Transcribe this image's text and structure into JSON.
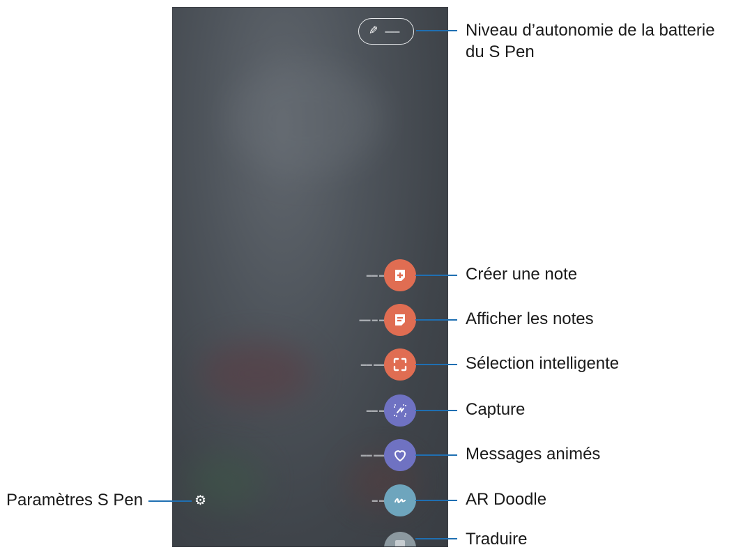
{
  "screen": {
    "battery_icon": "s-pen-icon",
    "settings_icon": "gear-icon",
    "shortcuts": [
      {
        "id": "create-note",
        "color": "#e06d52",
        "icon": "note-plus-icon"
      },
      {
        "id": "view-notes",
        "color": "#e06d52",
        "icon": "note-list-icon"
      },
      {
        "id": "smart-select",
        "color": "#e06d52",
        "icon": "crop-select-icon"
      },
      {
        "id": "screen-write",
        "color": "#6f72c2",
        "icon": "screen-write-icon"
      },
      {
        "id": "live-messages",
        "color": "#6f72c2",
        "icon": "heart-icon"
      },
      {
        "id": "ar-doodle",
        "color": "#6ea5bd",
        "icon": "doodle-icon"
      },
      {
        "id": "translate",
        "color": "#8c99a0",
        "icon": "translate-icon"
      }
    ]
  },
  "callouts": {
    "battery_line1": "Niveau d’autonomie de la batterie",
    "battery_line2": "du S Pen",
    "create_note": "Créer une note",
    "view_notes": "Afficher les notes",
    "smart_select": "Sélection intelligente",
    "capture": "Capture",
    "live_messages": "Messages animés",
    "ar_doodle": "AR Doodle",
    "translate": "Traduire",
    "settings": "Paramètres S Pen"
  },
  "colors": {
    "callout_line": "#1f6fb2",
    "orange": "#e06d52",
    "purple": "#6f72c2",
    "teal": "#6ea5bd"
  }
}
